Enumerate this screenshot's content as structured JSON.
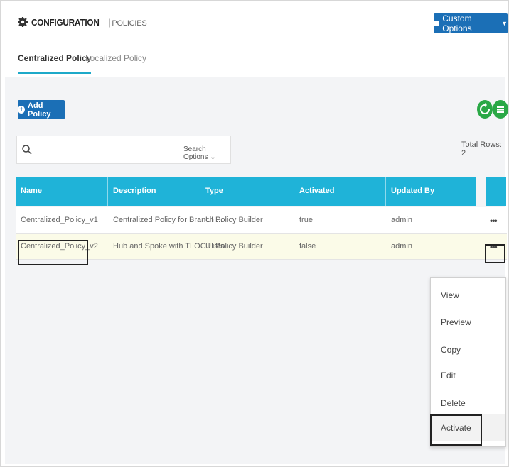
{
  "header": {
    "section": "CONFIGURATION",
    "separator": "|",
    "page": "POLICIES",
    "custom_options": "Custom Options"
  },
  "tabs": [
    {
      "label": "Centralized Policy",
      "active": true
    },
    {
      "label": "Localized Policy",
      "active": false
    }
  ],
  "toolbar": {
    "add_policy": "Add Policy",
    "search_placeholder": "",
    "search_options": "Search Options",
    "total_rows": "Total Rows: 2"
  },
  "table": {
    "columns": [
      "Name",
      "Description",
      "Type",
      "Activated",
      "Updated By"
    ],
    "rows": [
      {
        "name": "Centralized_Policy_v1",
        "description": "Centralized Policy for Branch ...",
        "type": "UI Policy Builder",
        "activated": "true",
        "updated_by": "admin",
        "more": "•••"
      },
      {
        "name": "Centralized_Policy_v2",
        "description": "Hub and Spoke with TLOC Lists",
        "type": "UI Policy Builder",
        "activated": "false",
        "updated_by": "admin",
        "more": "•••"
      }
    ]
  },
  "dropdown": {
    "items": [
      "View",
      "Preview",
      "Copy",
      "Edit",
      "Delete",
      "Activate"
    ]
  },
  "colors": {
    "primary": "#1b6fb6",
    "table_header": "#1fb3d8",
    "tab_underline": "#1da9c9",
    "green": "#2aa846",
    "selected_row": "#fbfbe8"
  },
  "icons": [
    "gear-icon",
    "caret-down-icon",
    "plus-icon",
    "refresh-icon",
    "list-menu-icon",
    "search-icon",
    "chevron-down-icon",
    "more-icon"
  ]
}
